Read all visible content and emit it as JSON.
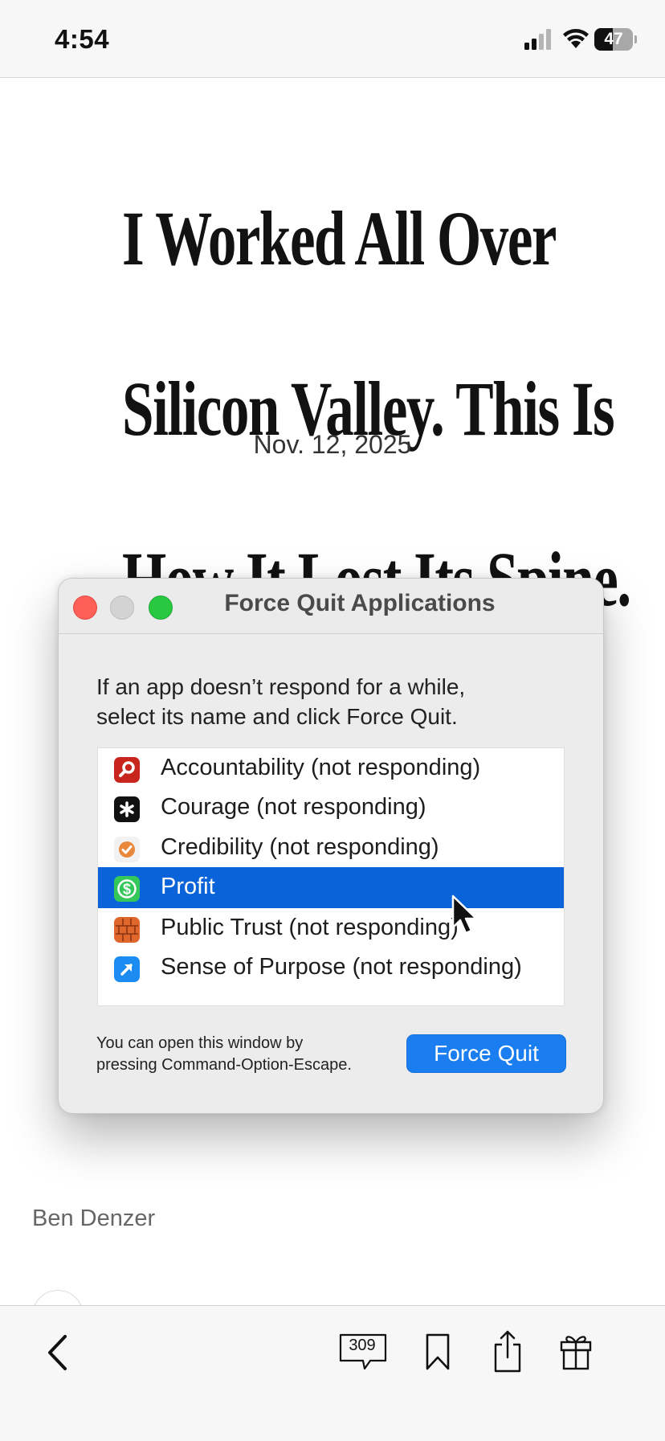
{
  "status_bar": {
    "time": "4:54",
    "battery_percent": "47",
    "battery_level": 0.47
  },
  "article": {
    "headline_lines": [
      "I Worked All Over",
      "Silicon Valley. This Is",
      "How It Lost Its Spine."
    ],
    "date": "Nov. 12, 2025",
    "byline": "Ben Denzer"
  },
  "illustration": {
    "window_title": "Force Quit Applications",
    "instruction_lines": [
      "If an app doesn’t respond for a while,",
      "select its name and click Force Quit."
    ],
    "apps": [
      {
        "name": "Accountability (not responding)",
        "icon": "magnifier-icon",
        "color": "#c8261c",
        "selected": false
      },
      {
        "name": "Courage (not responding)",
        "icon": "asterisk-icon",
        "color": "#111111",
        "selected": false
      },
      {
        "name": "Credibility (not responding)",
        "icon": "checkmark-badge-icon",
        "color": "#e9873a",
        "selected": false
      },
      {
        "name": "Profit",
        "icon": "dollar-icon",
        "color": "#34c759",
        "selected": true
      },
      {
        "name": "Public Trust (not responding)",
        "icon": "brick-wall-icon",
        "color": "#e0672c",
        "selected": false
      },
      {
        "name": "Sense of Purpose (not responding)",
        "icon": "arrow-icon",
        "color": "#1d8cf2",
        "selected": false
      }
    ],
    "hint_lines": [
      "You can open this window by",
      "pressing Command-Option-Escape."
    ],
    "force_quit_label": "Force Quit"
  },
  "toolbar": {
    "comment_count": "309"
  }
}
